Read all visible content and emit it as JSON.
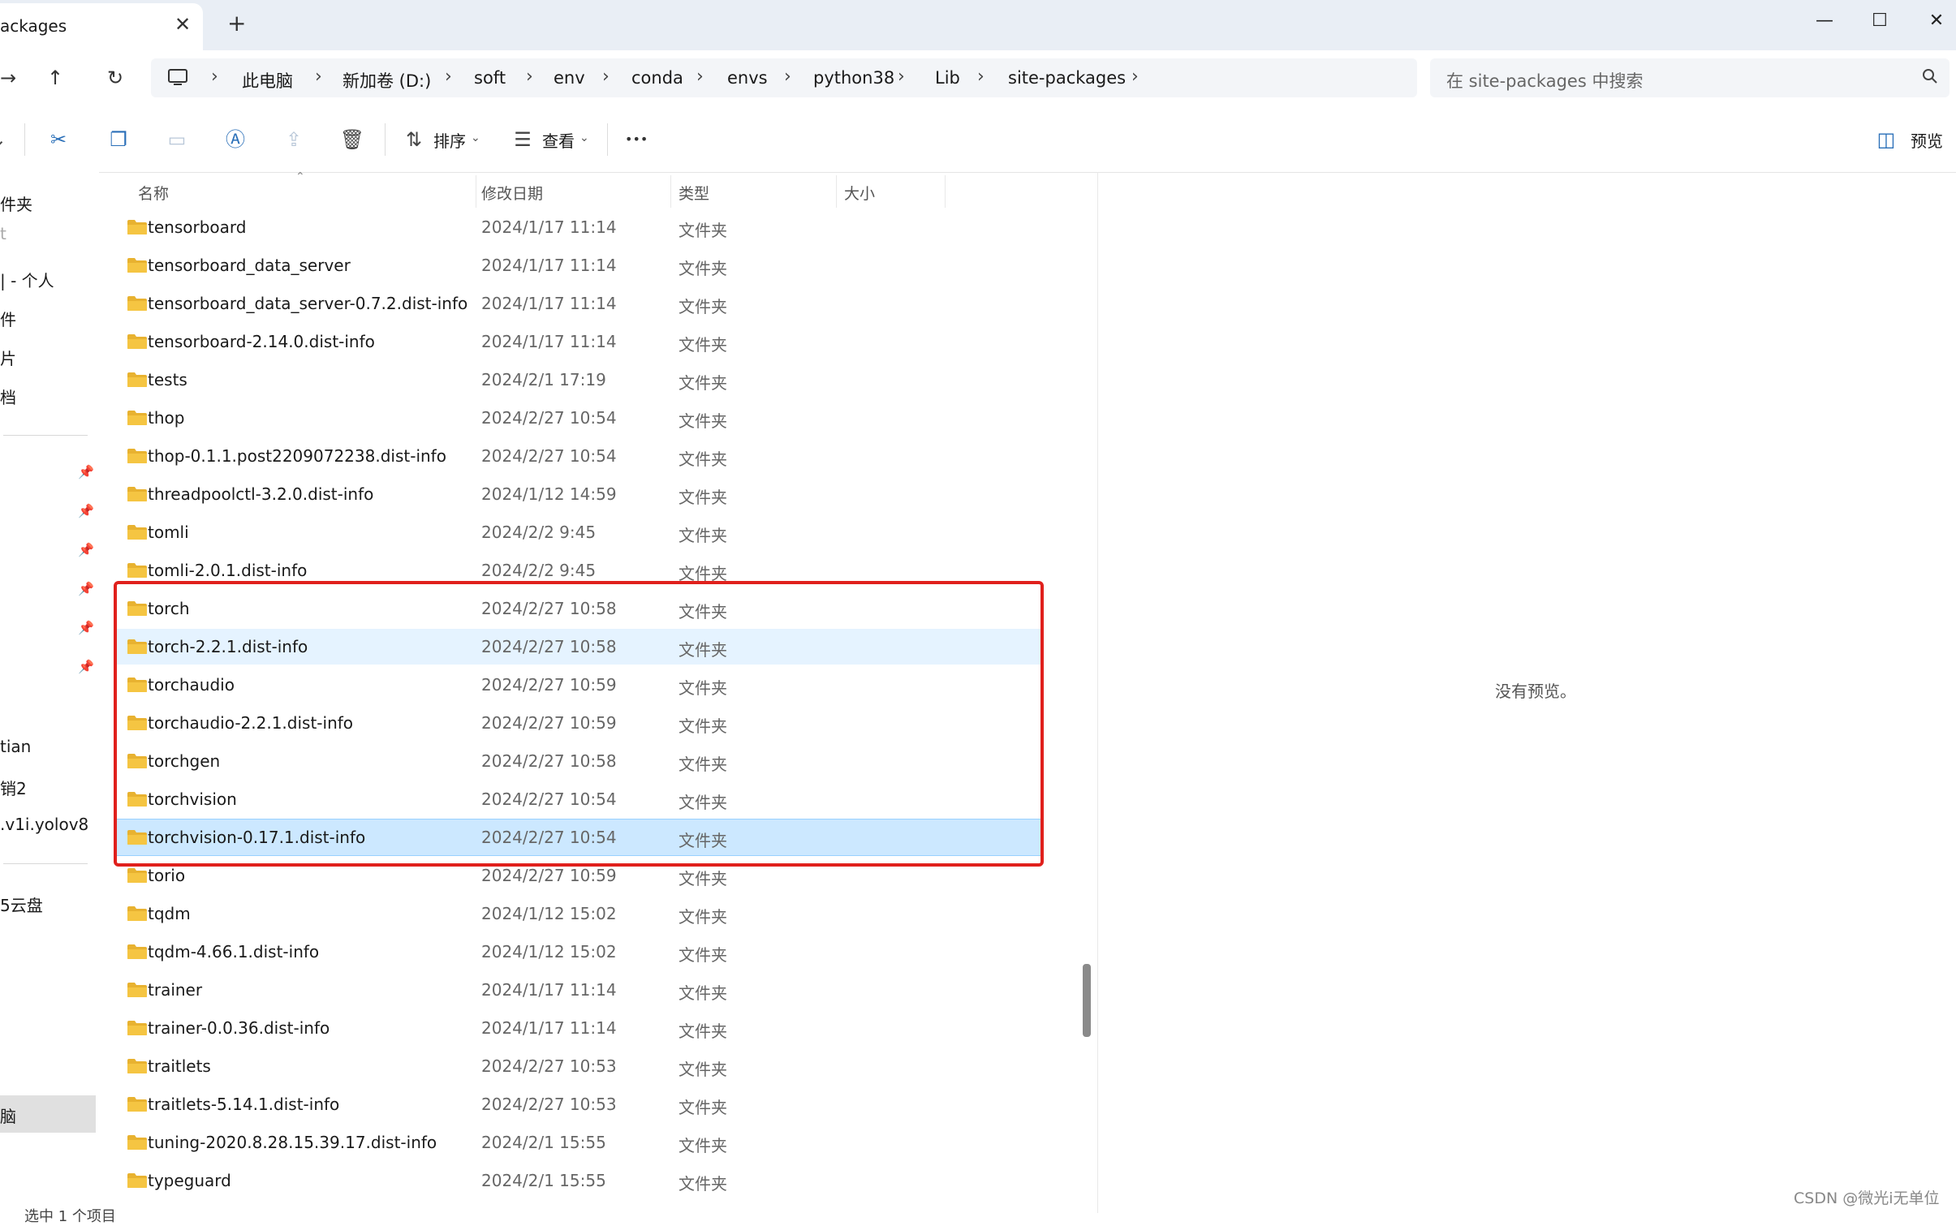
{
  "tab": {
    "title": "ackages",
    "close": "✕",
    "new": "+"
  },
  "window": {
    "minimize": "—",
    "maximize": "☐",
    "close": "✕"
  },
  "address": {
    "crumbs": [
      "此电脑",
      "新加卷 (D:)",
      "soft",
      "env",
      "conda",
      "envs",
      "python38",
      "Lib",
      "site-packages"
    ],
    "separator": "›"
  },
  "search": {
    "placeholder": "在 site-packages 中搜索"
  },
  "toolbar": {
    "sort_label": "排序",
    "view_label": "查看",
    "more": "•••",
    "preview_label": "预览"
  },
  "sidebar": {
    "items": [
      "件夹",
      "t",
      "| - 个人",
      "件",
      "片",
      "档",
      "tian",
      "销2",
      ".v1i.yolov8",
      "5云盘",
      "脑"
    ]
  },
  "columns": {
    "name": "名称",
    "date": "修改日期",
    "type": "类型",
    "size": "大小"
  },
  "rows": [
    {
      "name": "tensorboard",
      "date": "2024/1/17 11:14",
      "type": "文件夹"
    },
    {
      "name": "tensorboard_data_server",
      "date": "2024/1/17 11:14",
      "type": "文件夹"
    },
    {
      "name": "tensorboard_data_server-0.7.2.dist-info",
      "date": "2024/1/17 11:14",
      "type": "文件夹"
    },
    {
      "name": "tensorboard-2.14.0.dist-info",
      "date": "2024/1/17 11:14",
      "type": "文件夹"
    },
    {
      "name": "tests",
      "date": "2024/2/1 17:19",
      "type": "文件夹"
    },
    {
      "name": "thop",
      "date": "2024/2/27 10:54",
      "type": "文件夹"
    },
    {
      "name": "thop-0.1.1.post2209072238.dist-info",
      "date": "2024/2/27 10:54",
      "type": "文件夹"
    },
    {
      "name": "threadpoolctl-3.2.0.dist-info",
      "date": "2024/1/12 14:59",
      "type": "文件夹"
    },
    {
      "name": "tomli",
      "date": "2024/2/2 9:45",
      "type": "文件夹"
    },
    {
      "name": "tomli-2.0.1.dist-info",
      "date": "2024/2/2 9:45",
      "type": "文件夹"
    },
    {
      "name": "torch",
      "date": "2024/2/27 10:58",
      "type": "文件夹"
    },
    {
      "name": "torch-2.2.1.dist-info",
      "date": "2024/2/27 10:58",
      "type": "文件夹"
    },
    {
      "name": "torchaudio",
      "date": "2024/2/27 10:59",
      "type": "文件夹"
    },
    {
      "name": "torchaudio-2.2.1.dist-info",
      "date": "2024/2/27 10:59",
      "type": "文件夹"
    },
    {
      "name": "torchgen",
      "date": "2024/2/27 10:58",
      "type": "文件夹"
    },
    {
      "name": "torchvision",
      "date": "2024/2/27 10:54",
      "type": "文件夹"
    },
    {
      "name": "torchvision-0.17.1.dist-info",
      "date": "2024/2/27 10:54",
      "type": "文件夹"
    },
    {
      "name": "torio",
      "date": "2024/2/27 10:59",
      "type": "文件夹"
    },
    {
      "name": "tqdm",
      "date": "2024/1/12 15:02",
      "type": "文件夹"
    },
    {
      "name": "tqdm-4.66.1.dist-info",
      "date": "2024/1/12 15:02",
      "type": "文件夹"
    },
    {
      "name": "trainer",
      "date": "2024/1/17 11:14",
      "type": "文件夹"
    },
    {
      "name": "trainer-0.0.36.dist-info",
      "date": "2024/1/17 11:14",
      "type": "文件夹"
    },
    {
      "name": "traitlets",
      "date": "2024/2/27 10:53",
      "type": "文件夹"
    },
    {
      "name": "traitlets-5.14.1.dist-info",
      "date": "2024/2/27 10:53",
      "type": "文件夹"
    },
    {
      "name": "tuning-2020.8.28.15.39.17.dist-info",
      "date": "2024/2/1 15:55",
      "type": "文件夹"
    },
    {
      "name": "typeguard",
      "date": "2024/2/1 15:55",
      "type": "文件夹"
    }
  ],
  "preview": {
    "empty_text": "没有预览。"
  },
  "status": {
    "text": "选中 1 个项目"
  },
  "watermark": "CSDN @微光i无单位",
  "colors": {
    "selection": "#cce8ff",
    "hover": "#e5f3ff",
    "annotation_box": "#e0201c",
    "folder": "#f5c542"
  }
}
